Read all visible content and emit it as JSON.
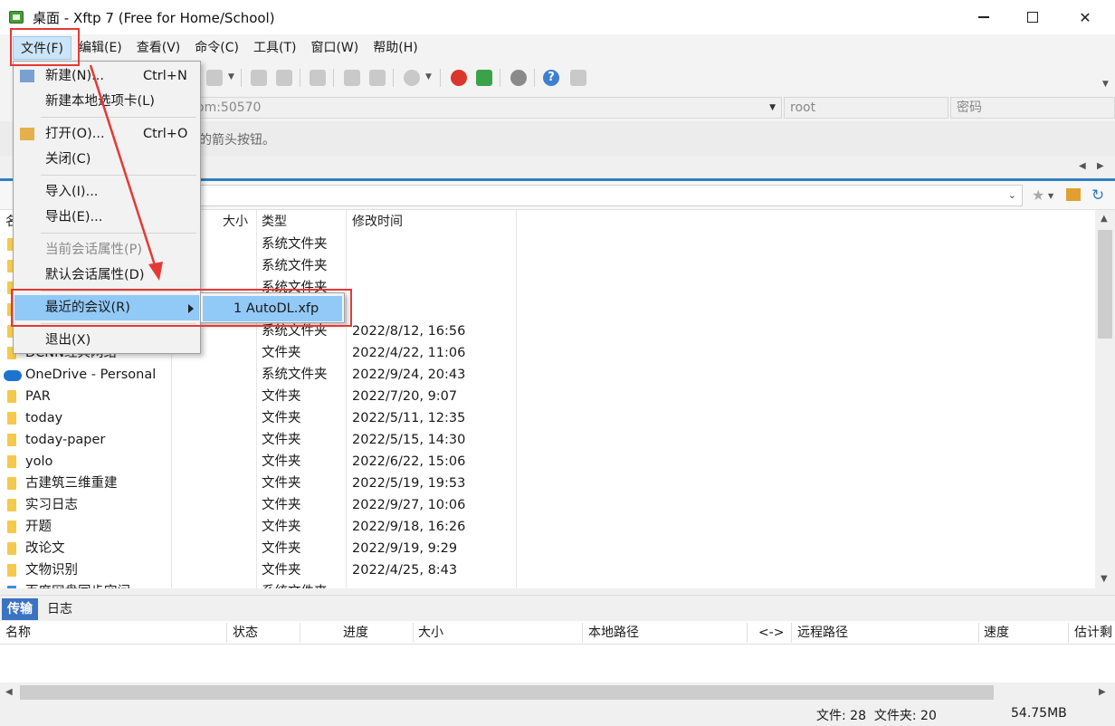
{
  "window": {
    "title": "桌面 - Xftp 7 (Free for Home/School)",
    "min_glyph": "—",
    "close_glyph": "✕"
  },
  "menubar": {
    "items": [
      "文件(F)",
      "编辑(E)",
      "查看(V)",
      "命令(C)",
      "工具(T)",
      "窗口(W)",
      "帮助(H)"
    ]
  },
  "address": {
    "host_fragment": "om:50570",
    "user": "root",
    "password_placeholder": "密码",
    "hint_fragment": "的箭头按钮。"
  },
  "file_list": {
    "columns": [
      "名",
      "大小",
      "类型",
      "修改时间"
    ],
    "rows": [
      {
        "name": "",
        "type": "系统文件夹",
        "modified": "",
        "icon": "folder-icon"
      },
      {
        "name": "",
        "type": "系统文件夹",
        "modified": "",
        "icon": "folder-icon"
      },
      {
        "name": "",
        "type": "系统文件夹",
        "modified": "",
        "icon": "folder-icon"
      },
      {
        "name": "",
        "type": "",
        "modified": "",
        "icon": "folder-icon"
      },
      {
        "name": "",
        "type": "系统文件夹",
        "modified": "2022/8/12, 16:56",
        "icon": "folder-icon"
      },
      {
        "name": "DCNN经典网络",
        "type": "文件夹",
        "modified": "2022/4/22, 11:06",
        "icon": "folder-icon"
      },
      {
        "name": "OneDrive - Personal",
        "type": "系统文件夹",
        "modified": "2022/9/24, 20:43",
        "icon": "onedrive-icon"
      },
      {
        "name": "PAR",
        "type": "文件夹",
        "modified": "2022/7/20, 9:07",
        "icon": "folder-icon"
      },
      {
        "name": "today",
        "type": "文件夹",
        "modified": "2022/5/11, 12:35",
        "icon": "folder-icon"
      },
      {
        "name": "today-paper",
        "type": "文件夹",
        "modified": "2022/5/15, 14:30",
        "icon": "folder-icon"
      },
      {
        "name": "yolo",
        "type": "文件夹",
        "modified": "2022/6/22, 15:06",
        "icon": "folder-icon"
      },
      {
        "name": "古建筑三维重建",
        "type": "文件夹",
        "modified": "2022/5/19, 19:53",
        "icon": "folder-icon"
      },
      {
        "name": "实习日志",
        "type": "文件夹",
        "modified": "2022/9/27, 10:06",
        "icon": "folder-icon"
      },
      {
        "name": "开题",
        "type": "文件夹",
        "modified": "2022/9/18, 16:26",
        "icon": "folder-icon"
      },
      {
        "name": "改论文",
        "type": "文件夹",
        "modified": "2022/9/19, 9:29",
        "icon": "folder-icon"
      },
      {
        "name": "文物识别",
        "type": "文件夹",
        "modified": "2022/4/25, 8:43",
        "icon": "folder-icon"
      },
      {
        "name": "百度网盘同步空间",
        "type": "系统文件夹",
        "modified": "",
        "icon": "baidu-sync-icon"
      }
    ]
  },
  "file_menu": {
    "items": [
      {
        "label": "新建(N)...",
        "shortcut": "Ctrl+N",
        "icon": "new-session-icon"
      },
      {
        "label": "新建本地选项卡(L)",
        "shortcut": ""
      },
      {
        "label": "打开(O)...",
        "shortcut": "Ctrl+O",
        "icon": "open-folder-icon"
      },
      {
        "label": "关闭(C)",
        "shortcut": ""
      },
      {
        "label": "导入(I)...",
        "shortcut": ""
      },
      {
        "label": "导出(E)...",
        "shortcut": ""
      },
      {
        "label": "当前会话属性(P)",
        "shortcut": "",
        "disabled": true
      },
      {
        "label": "默认会话属性(D)",
        "shortcut": ""
      },
      {
        "label": "最近的会议(R)",
        "shortcut": "",
        "submenu": true
      },
      {
        "label": "退出(X)",
        "shortcut": ""
      }
    ],
    "recent_submenu": [
      "1 AutoDL.xfp"
    ]
  },
  "bottom_tabs": [
    "传输",
    "日志"
  ],
  "transfer_columns": [
    "名称",
    "状态",
    "进度",
    "大小",
    "本地路径",
    "<->",
    "远程路径",
    "速度",
    "估计剩"
  ],
  "status": {
    "counts": "文件: 28  文件夹: 20",
    "size": "54.75MB"
  },
  "colors": {
    "accent_blue": "#2f7fc1",
    "menu_hover": "#91c9f7",
    "annotation_red": "#e53935"
  }
}
